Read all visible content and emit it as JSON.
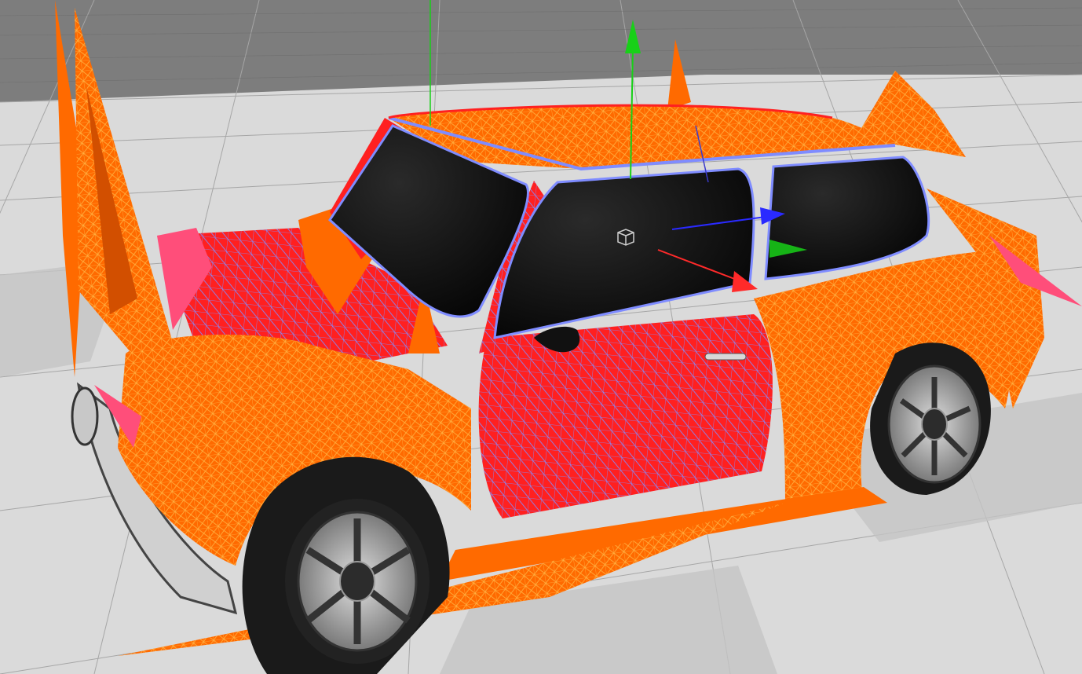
{
  "viewport": {
    "kind": "3d-editor-viewport",
    "shading": "wireframe-on-shaded",
    "object": "mini-car-mesh",
    "colors": {
      "background": "#8c8c8c",
      "floor_light": "#dadada",
      "floor_dark": "#b9b9b9",
      "floor_far": "#7b7b7b",
      "body_red": "#ff2020",
      "body_orange": "#ff6a00",
      "wire_orange": "#ffb040",
      "wire_blue": "#6a7cff",
      "glass": "#0c0c0c",
      "tire": "#1a1a1a",
      "rim": "#b8b8b8",
      "axis_x": "#ff2a2a",
      "axis_y": "#18d018",
      "axis_z": "#2a2aff"
    },
    "icons": [
      "gizmo-x-arrow-icon",
      "gizmo-y-arrow-icon",
      "gizmo-z-arrow-icon",
      "pivot-cube-icon",
      "scale-plane-handle-icon"
    ]
  }
}
